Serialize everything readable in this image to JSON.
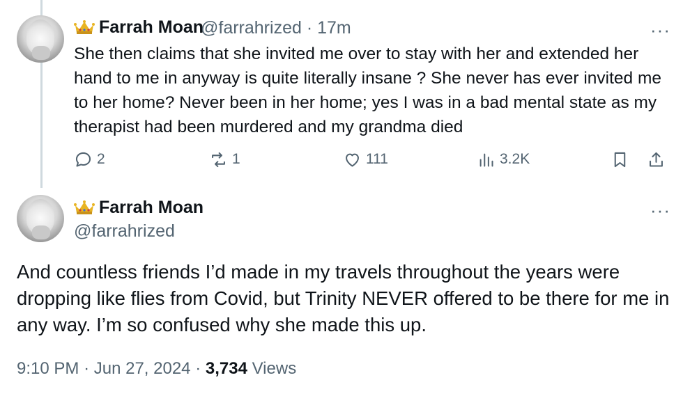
{
  "tweet1": {
    "display_name": "Farrah Moan",
    "handle": "@farrahrized",
    "separator": "·",
    "time": "17m",
    "text": "She then claims that she invited me over  to stay with her and extended her hand to me in anyway is quite literally insane ? She never has ever invited me to her home? Never been in her home; yes I was in a bad mental state as my therapist had been murdered and my grandma died",
    "replies": "2",
    "reposts": "1",
    "likes": "111",
    "views": "3.2K"
  },
  "tweet2": {
    "display_name": "Farrah Moan",
    "handle": "@farrahrized",
    "text": "And countless friends I’d made in my travels throughout the years were dropping like flies from Covid, but Trinity NEVER offered to be there for me in any way. I’m so confused why she made this up.",
    "time": "9:10 PM",
    "dot": "·",
    "date": "Jun 27, 2024",
    "views_count": "3,734",
    "views_label": "Views"
  },
  "more_glyph": "···",
  "colors": {
    "text": "#0f1419",
    "secondary": "#536471",
    "thread": "#cfd9de",
    "crown": "#e8b423"
  }
}
